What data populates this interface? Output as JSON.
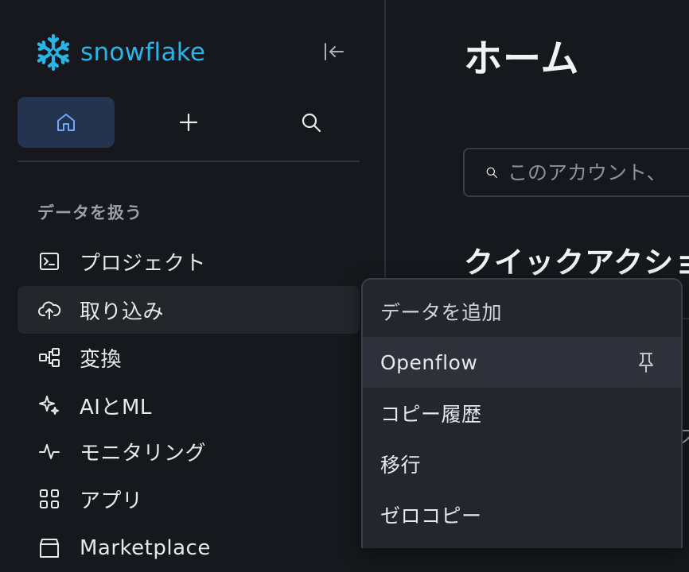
{
  "brand": {
    "name": "snowflake",
    "color": "#29b5e8"
  },
  "sidebar": {
    "collapse_icon": "collapse-left-icon",
    "top_nav": [
      {
        "id": "home",
        "icon": "home-icon",
        "active": true
      },
      {
        "id": "create",
        "icon": "plus-icon",
        "active": false
      },
      {
        "id": "search",
        "icon": "search-icon",
        "active": false
      }
    ],
    "section_label": "データを扱う",
    "items": [
      {
        "label": "プロジェクト",
        "icon": "terminal-icon"
      },
      {
        "label": "取り込み",
        "icon": "cloud-upload-icon",
        "hover": true
      },
      {
        "label": "変換",
        "icon": "transform-icon"
      },
      {
        "label": "AIとML",
        "icon": "sparkle-icon"
      },
      {
        "label": "モニタリング",
        "icon": "activity-icon"
      },
      {
        "label": "アプリ",
        "icon": "grid-icon"
      },
      {
        "label": "Marketplace",
        "icon": "marketplace-icon"
      }
    ]
  },
  "main": {
    "title": "ホーム",
    "search": {
      "placeholder": "このアカウント、"
    },
    "section_title": "クイックアクショ",
    "peek_char": "ス"
  },
  "popup": {
    "header": "データを追加",
    "items": [
      {
        "label": "Openflow",
        "hover": true,
        "icon": "pin-icon"
      },
      {
        "label": "コピー履歴"
      },
      {
        "label": "移行"
      },
      {
        "label": "ゼロコピー"
      }
    ]
  },
  "colors": {
    "background": "#16181d",
    "active_nav": "#24344f",
    "popup_bg": "#23262d",
    "accent": "#29b5e8"
  }
}
